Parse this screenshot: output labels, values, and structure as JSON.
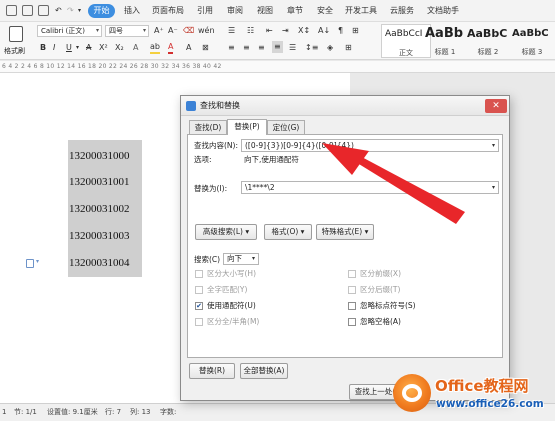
{
  "menubar": {
    "start_label": "开始",
    "items": [
      "插入",
      "页面布局",
      "引用",
      "审阅",
      "视图",
      "章节",
      "安全",
      "开发工具",
      "云服务",
      "文档助手"
    ]
  },
  "ribbon": {
    "paste_label": "格式刷",
    "font_name": "Calibri (正文)",
    "font_size": "四号",
    "grow_font": "A⁺",
    "shrink_font": "A⁻",
    "bold": "B",
    "italic": "I",
    "underline": "U",
    "font_color": "A",
    "styles": [
      {
        "sample": "AaBbCcI",
        "name": "正文"
      },
      {
        "sample": "AaBb",
        "name": "标题 1"
      },
      {
        "sample": "AaBbC",
        "name": "标题 2"
      },
      {
        "sample": "AaBbC",
        "name": "标题 3"
      }
    ]
  },
  "ruler": {
    "numbers": "6  4  2     2  4  6  8  10  12  14  16  18  20  22  24  26  28  30  32  34  36  38  40  42"
  },
  "document": {
    "lines": [
      "13200031000",
      "13200031001",
      "13200031002",
      "13200031003",
      "13200031004"
    ]
  },
  "statusbar": {
    "items": [
      "1",
      "节: 1/1",
      "设置值: 9.1厘米",
      "行: 7",
      "列: 13",
      "字数:"
    ]
  },
  "dialog": {
    "title": "查找和替换",
    "close_symbol": "✕",
    "tabs": [
      "查找(D)",
      "替换(P)",
      "定位(G)"
    ],
    "find_label": "查找内容(N):",
    "find_value": "([0-9]{3})[0-9]{4}([0-9]{4})",
    "options_label": "选项:",
    "options_value": "向下,使用通配符",
    "replace_label": "替换为(I):",
    "replace_value": "\\1****\\2",
    "btn_advanced": "高级搜索(L) ▾",
    "btn_format": "格式(O) ▾",
    "btn_special": "特殊格式(E) ▾",
    "search_label": "搜索(C)",
    "search_value": "向下",
    "checkboxes_left": [
      {
        "label": "区分大小写(H)",
        "checked": false,
        "enabled": false
      },
      {
        "label": "全字匹配(Y)",
        "checked": false,
        "enabled": false
      },
      {
        "label": "使用通配符(U)",
        "checked": true,
        "enabled": true
      },
      {
        "label": "区分全/半角(M)",
        "checked": false,
        "enabled": false
      }
    ],
    "checkboxes_right": [
      {
        "label": "区分前缀(X)",
        "checked": false,
        "enabled": false
      },
      {
        "label": "区分后缀(T)",
        "checked": false,
        "enabled": false
      },
      {
        "label": "忽略标点符号(S)",
        "checked": false,
        "enabled": true
      },
      {
        "label": "忽略空格(A)",
        "checked": false,
        "enabled": true
      }
    ],
    "btn_replace": "替换(R)",
    "btn_replace_all": "全部替换(A)",
    "btn_find_prev": "查找上一处(B)"
  },
  "watermark": {
    "title": "Office教程网",
    "url": "www.office26.com"
  },
  "colors": {
    "accent_blue": "#3d8ee0",
    "arrow_red": "#e8262a",
    "watermark_orange": "#e4651a",
    "watermark_blue": "#1a5fb7"
  }
}
